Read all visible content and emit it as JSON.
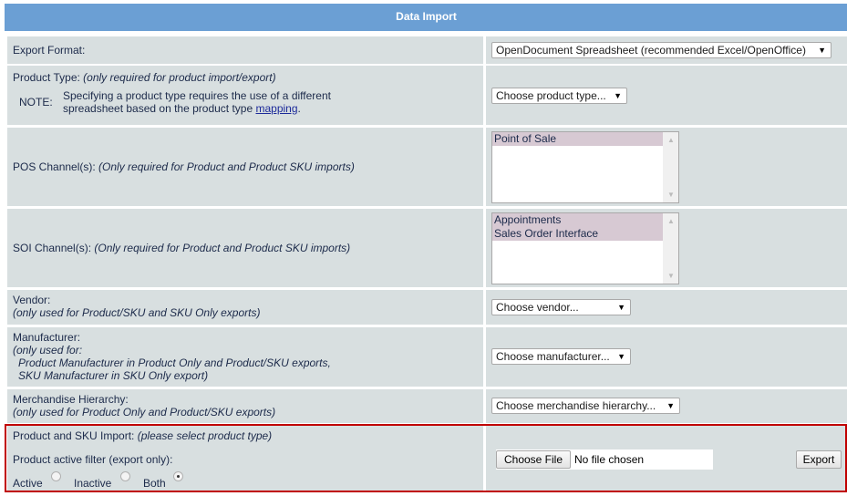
{
  "header": {
    "title": "Data Import"
  },
  "rows": {
    "export_format": {
      "label": "Export Format:",
      "select": "OpenDocument Spreadsheet (recommended Excel/OpenOffice)"
    },
    "product_type": {
      "label": "Product Type:",
      "hint": "(only required for product import/export)",
      "note_label": "NOTE:",
      "note_line1": "Specifying a product type requires the use of a different",
      "note_line2": "spreadsheet based on the product type",
      "note_link": "mapping",
      "note_end": ".",
      "select": "Choose product type..."
    },
    "pos_channel": {
      "label": "POS Channel(s):",
      "hint": "(Only required for Product and Product SKU imports)",
      "options": [
        "Point of Sale"
      ]
    },
    "soi_channel": {
      "label": "SOI Channel(s):",
      "hint": "(Only required for Product and Product SKU imports)",
      "options": [
        "Appointments",
        "Sales Order Interface"
      ]
    },
    "vendor": {
      "label": "Vendor:",
      "hint": "(only used for Product/SKU and SKU Only exports)",
      "select": "Choose vendor..."
    },
    "manufacturer": {
      "label": "Manufacturer:",
      "hint1": "(only used for:",
      "hint2": "Product Manufacturer in Product Only and Product/SKU exports,",
      "hint3": "SKU Manufacturer in SKU Only export)",
      "select": "Choose manufacturer..."
    },
    "merch": {
      "label": "Merchandise Hierarchy:",
      "hint": "(only used for Product Only and Product/SKU exports)",
      "select": "Choose merchandise hierarchy..."
    },
    "import": {
      "label": "Product and SKU Import:",
      "hint": "(please select product type)",
      "filter_label": "Product active filter (export only):",
      "radios": [
        "Active",
        "Inactive",
        "Both"
      ],
      "selected": "Both",
      "choose_file": "Choose File",
      "no_file": "No file chosen",
      "export": "Export"
    }
  }
}
